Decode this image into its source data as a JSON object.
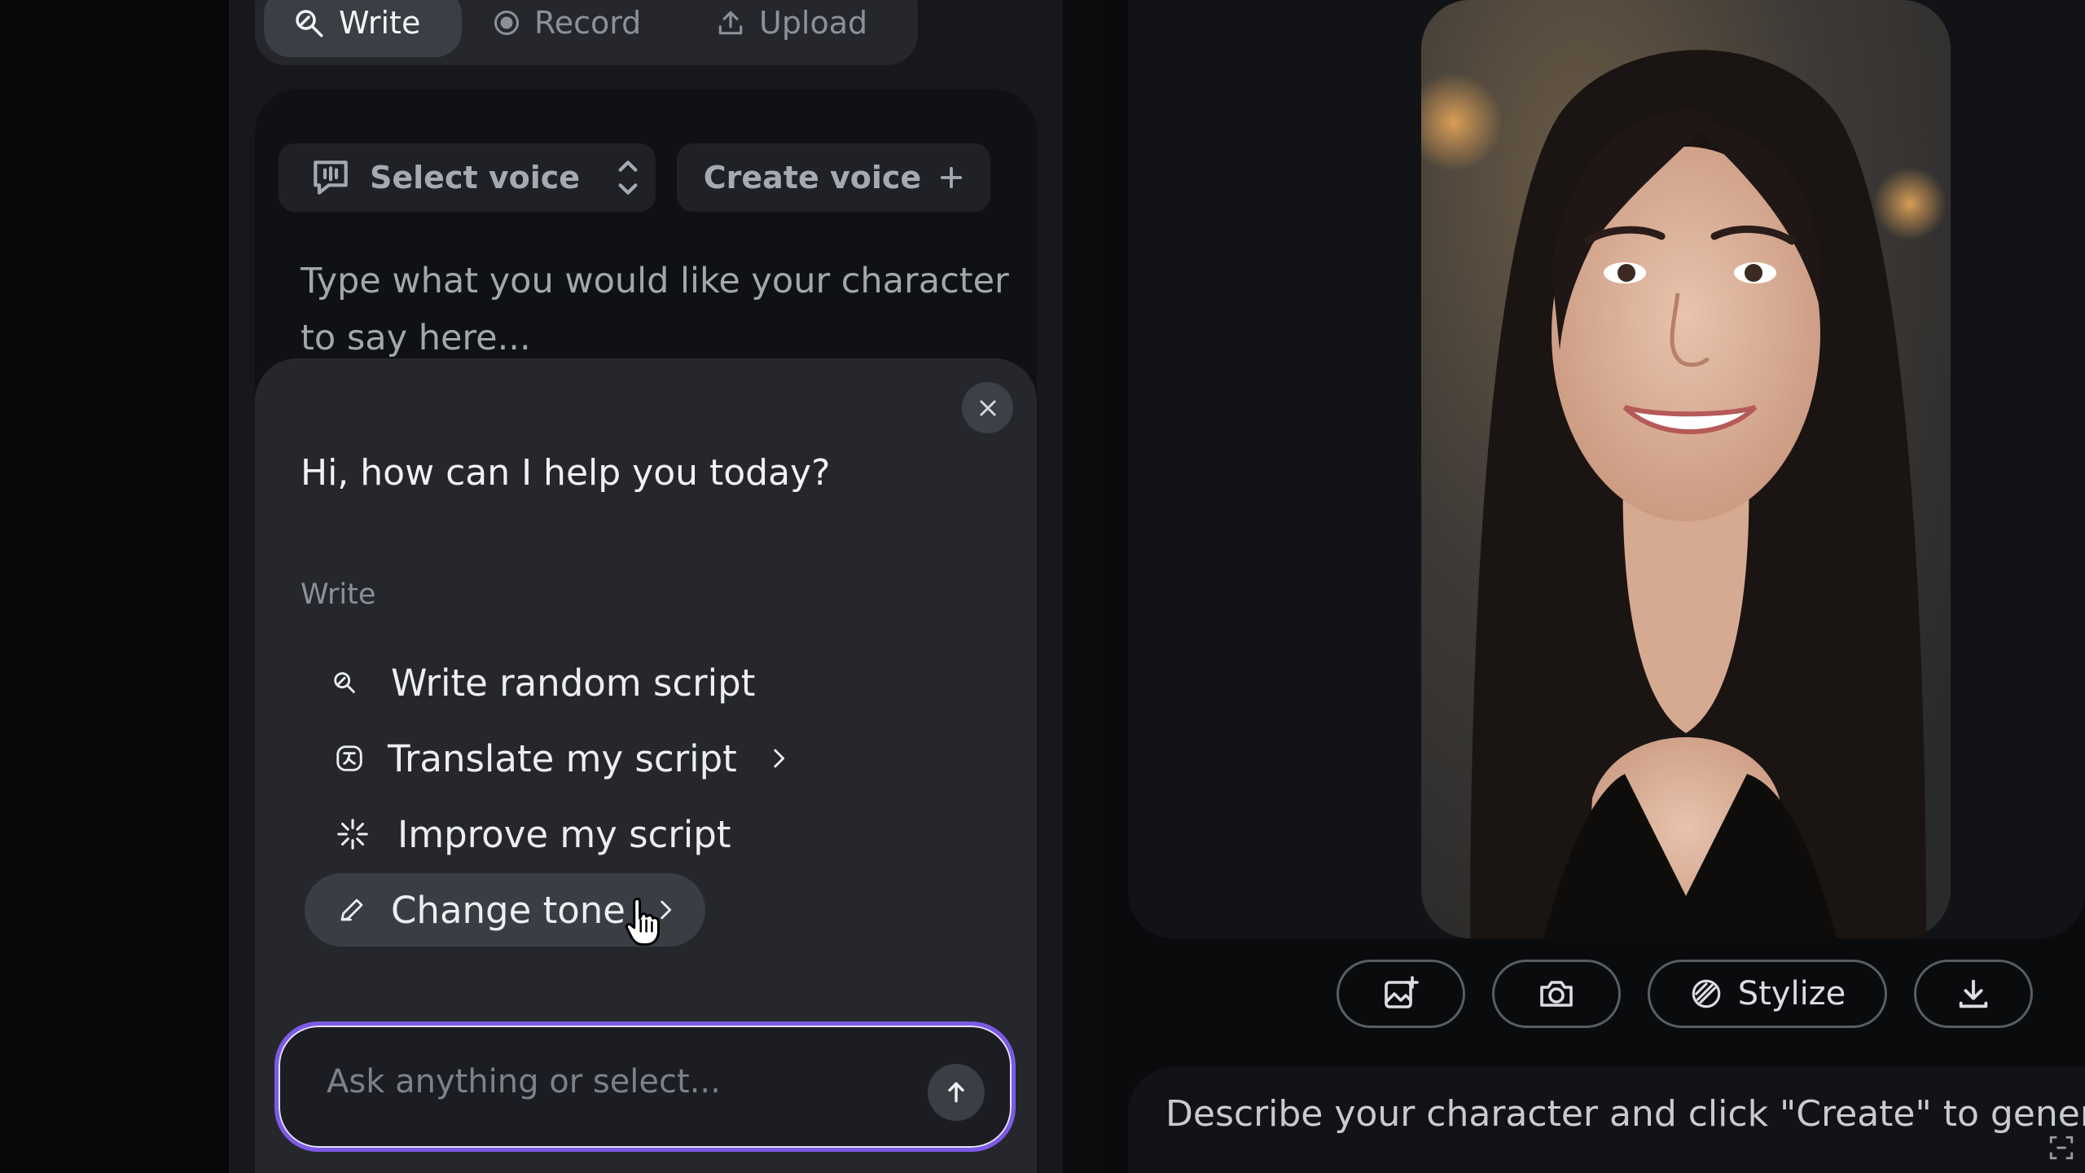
{
  "tabs": [
    {
      "label": "Write",
      "icon": "write-icon",
      "active": true
    },
    {
      "label": "Record",
      "icon": "record-icon",
      "active": false
    },
    {
      "label": "Upload",
      "icon": "upload-icon",
      "active": false
    }
  ],
  "voice": {
    "select_label": "Select voice",
    "create_label": "Create voice"
  },
  "script": {
    "placeholder": "Type what you would like your character to say here..."
  },
  "assistant": {
    "greeting": "Hi, how can I help you today?",
    "section_label": "Write",
    "items": [
      {
        "label": "Write random script",
        "icon": "pen-sparkle-icon"
      },
      {
        "label": "Translate my script",
        "icon": "translate-icon",
        "has_submenu": true
      },
      {
        "label": "Improve my script",
        "icon": "sparkle-icon"
      },
      {
        "label": "Change tone",
        "icon": "pen-icon",
        "has_submenu": true,
        "hovered": true
      }
    ],
    "ask_placeholder": "Ask anything or select..."
  },
  "character": {
    "toolbar": {
      "stylize_label": "Stylize"
    },
    "prompt_placeholder": "Describe your character and click \"Create\" to generat"
  },
  "colors": {
    "accent_border": "#7d5ae6",
    "panel": "#17181c",
    "popup": "#25272c"
  }
}
